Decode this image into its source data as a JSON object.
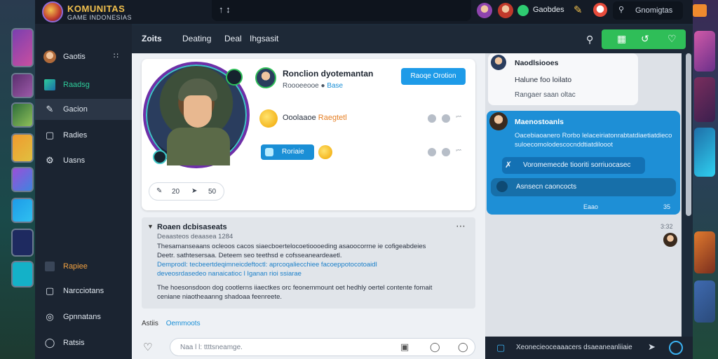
{
  "topbar": {
    "logo_title": "KOMUNITAS",
    "logo_subtitle": "GAME INDONESIAS",
    "search_text": "↑ ↕",
    "online_label": "Gaobdes",
    "global_search": "Gnomigtas"
  },
  "sidebar": {
    "items": [
      {
        "label": "Gaotis",
        "icon": "avatar-icon",
        "extra": "∷"
      },
      {
        "label": "Raadsg",
        "icon": "image-icon"
      },
      {
        "label": "Gacion",
        "icon": "pen-icon"
      },
      {
        "label": "Radies",
        "icon": "square-icon"
      },
      {
        "label": "Uasns",
        "icon": "gear-icon"
      },
      {
        "label": "Rapiee",
        "icon": "box-icon"
      },
      {
        "label": "Narcciotans",
        "icon": "square-icon"
      },
      {
        "label": "Gpnnatans",
        "icon": "globe-icon"
      },
      {
        "label": "Ratsis",
        "icon": "shield-icon"
      }
    ]
  },
  "tabs": [
    "Zoits",
    "Deating",
    "Deal",
    "Ihgsasit"
  ],
  "profile": {
    "name": "Ronclion dyotemantan",
    "subtitle": "Roooeeooe",
    "subtitle_link": "Base",
    "follow_button": "Raoqe Orotion",
    "status_text": "Ooolaaoe",
    "status_accent": "Raegtetl",
    "meta_1": "’ˆˆ",
    "meta_2": "’ˆˆ",
    "action_button": "Roriaie",
    "stat_left": "20",
    "stat_right": "50"
  },
  "post": {
    "title": "Roaen dcbisaseats",
    "subtitle": "Deaasteos deaasea 1284",
    "lines": [
      "Thesamanseaans ocleoos cacos siaecboertelocoetioooeding asaoocorrne ie cofigeabdeies",
      "Deetr. sathtesersaa. Deteem seo teethsd e cofsseaneardeaetl.",
      "Demprodl: tecbeertdeqimneicdeftoctl: aprcoqaliecchiee facoeppotocotoaidl",
      "deveosrdasedeo nanaicatioc l Iganan rioi ssiarae",
      "The hoesonsdoon dog cootlerns iiaectkes orc feonemmount oet hedhly oertel contente fomait",
      "ceniane niaotheaanng shadoaa feenreete."
    ]
  },
  "actions": {
    "left": "Astiis",
    "right": "Oemmoots"
  },
  "composer": {
    "placeholder": "Naa l l: ttttsneamge."
  },
  "chat": {
    "msg1_name": "Naodlsiooes",
    "msg1_line": "Halune foo loilato",
    "msg1_sub": "Rangaer saan oltac",
    "msg2_name": "Maenostoanls",
    "msg2_line1": "Oacebiaoanero Rorbo lelaceiriatonrabtatdiaetiatdieco",
    "msg2_line2": "suloecomolodescocnddtiatdilooot",
    "msg2_row1": "Voromemecde tiooriti sorriuocasec",
    "msg2_row2": "Asnsecn caoncocts",
    "msg2_time": "Eaao",
    "msg2_time_right": "35",
    "time_tail": "3:32",
    "input_placeholder": "Xeonecieoceaaacers dsaeaneanliiaie"
  }
}
